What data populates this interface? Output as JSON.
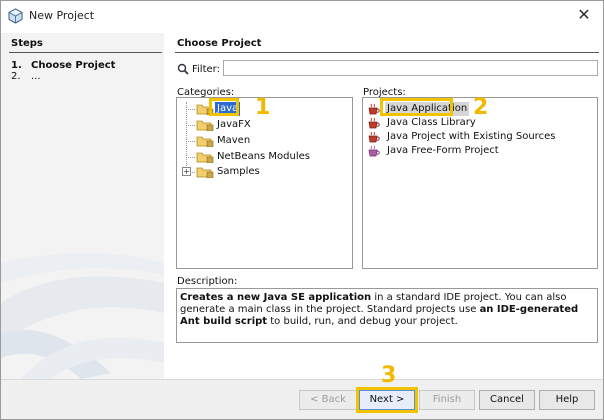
{
  "window": {
    "title": "New Project",
    "close_glyph": "✕"
  },
  "steps": {
    "title": "Steps",
    "items": [
      {
        "num": "1.",
        "label": "Choose Project"
      },
      {
        "num": "2.",
        "label": "..."
      }
    ]
  },
  "main": {
    "title": "Choose Project",
    "filter": {
      "label": "Filter:",
      "value": "",
      "icon": "search-icon"
    },
    "categories": {
      "label": "Categories:",
      "items": [
        {
          "label": "Java",
          "selected": true
        },
        {
          "label": "JavaFX"
        },
        {
          "label": "Maven"
        },
        {
          "label": "NetBeans Modules"
        },
        {
          "label": "Samples",
          "expandable": true,
          "expand_glyph": "+"
        }
      ]
    },
    "projects": {
      "label": "Projects:",
      "items": [
        {
          "label": "Java Application",
          "selected": true,
          "icon": "java-cup-icon"
        },
        {
          "label": "Java Class Library",
          "icon": "java-cup-icon"
        },
        {
          "label": "Java Project with Existing Sources",
          "icon": "java-cup-icon"
        },
        {
          "label": "Java Free-Form Project",
          "icon": "freeform-icon"
        }
      ]
    },
    "description": {
      "label": "Description:",
      "p1_bold": "Creates a new Java SE application",
      "p1_rest": " in a standard IDE project. You can also generate a main class in the project. Standard projects use ",
      "p2_bold": "an IDE-generated Ant build script",
      "p2_rest": " to build, run, and debug your project."
    }
  },
  "annotations": [
    "1",
    "2",
    "3"
  ],
  "highlight_color": "#f2c300",
  "buttons": {
    "back": "< Back",
    "next": "Next >",
    "finish": "Finish",
    "cancel": "Cancel",
    "help": "Help"
  }
}
